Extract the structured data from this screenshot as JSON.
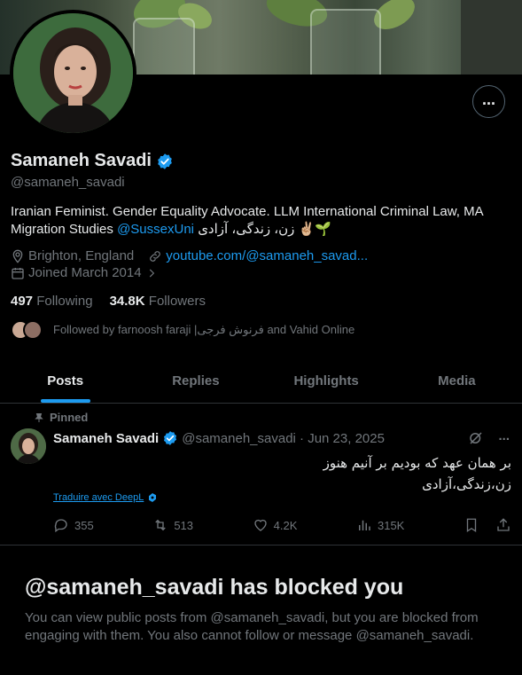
{
  "profile": {
    "name": "Samaneh Savadi",
    "handle": "@samaneh_savadi",
    "bio_text": "Iranian Feminist. Gender Equality Advocate. LLM International Criminal Law, MA Migration Studies",
    "bio_mention": "@SussexUni",
    "bio_tail": " زن، زندگی، آزادی ✌🏼🌱",
    "location": "Brighton, England",
    "website": "youtube.com/@samaneh_savad...",
    "joined": "Joined March 2014",
    "following_count": "497",
    "following_label": "Following",
    "followers_count": "34.8K",
    "followers_label": "Followers",
    "followed_by": "Followed by farnoosh faraji |فرنوش فرجی and Vahid Online"
  },
  "tabs": [
    {
      "label": "Posts"
    },
    {
      "label": "Replies"
    },
    {
      "label": "Highlights"
    },
    {
      "label": "Media"
    }
  ],
  "post": {
    "pinned_label": "Pinned",
    "author": "Samaneh Savadi",
    "handle_date": "@samaneh_savadi · Jun 23, 2025",
    "line1": "بر همان عهد که بودیم بر آنیم هنوز",
    "line2": "زن،زندگی،آزادی",
    "translate_label": "Traduire avec DeepL",
    "replies": "355",
    "reposts": "513",
    "likes": "4.2K",
    "views": "315K"
  },
  "blocked": {
    "title": "@samaneh_savadi has blocked you",
    "body": "You can view public posts from @samaneh_savadi, but you are blocked from engaging with them. You also cannot follow or message @samaneh_savadi."
  },
  "colors": {
    "background": "#000000",
    "text": "#e7e9ea",
    "muted": "#71767b",
    "accent": "#1d9bf0",
    "border": "#2f3336"
  },
  "icons": {
    "more": "more-dots-icon",
    "verified": "verified-badge-icon",
    "location": "location-pin-icon",
    "link": "link-icon",
    "calendar": "calendar-icon",
    "pin": "pin-icon",
    "grok": "grok-icon",
    "reply": "reply-icon",
    "repost": "repost-icon",
    "like": "heart-icon",
    "views": "views-icon",
    "bookmark": "bookmark-icon",
    "share": "share-icon"
  }
}
